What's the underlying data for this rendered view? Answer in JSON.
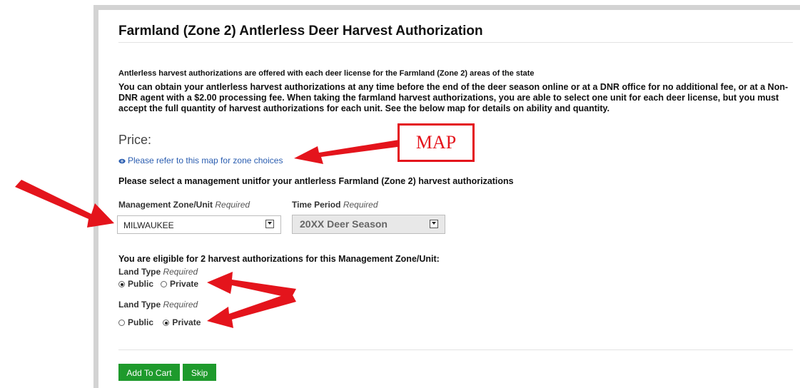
{
  "page": {
    "title": "Farmland (Zone 2) Antlerless Deer Harvest Authorization",
    "intro_small": "Antlerless harvest authorizations are offered with each deer license for the Farmland (Zone 2) areas of the state",
    "intro_para": "You can obtain your antlerless harvest authorizations at any time before the end of the deer season online or at a DNR office for no additional fee, or at a Non-DNR agent with a $2.00 processing fee.  When taking the farmland harvest authorizations, you are able to select one unit for each deer license, but you must accept the full quantity of harvest authorizations for each unit.  See the below map for details on ability and quantity.",
    "price_label": "Price:",
    "map_link": "Please refer to this map for zone choices",
    "select_heading": "Please select a management unitfor your antlerless Farmland (Zone 2) harvest authorizations"
  },
  "form": {
    "zone_label": "Management Zone/Unit",
    "zone_required": "Required",
    "zone_value": "MILWAUKEE",
    "period_label": "Time Period",
    "period_required": "Required",
    "period_value": "20XX Deer Season",
    "eligible_text": "You are eligible for 2 harvest authorizations for this Management Zone/Unit:",
    "land_types": [
      {
        "label": "Land Type",
        "required": "Required",
        "public": "Public",
        "private": "Private",
        "selected": "Public"
      },
      {
        "label": "Land Type",
        "required": "Required",
        "public": "Public",
        "private": "Private",
        "selected": "Private"
      }
    ]
  },
  "buttons": {
    "add_to_cart": "Add To Cart",
    "skip": "Skip"
  },
  "annotation": {
    "map_callout": "MAP",
    "color": "#e4141c"
  },
  "colors": {
    "button_green": "#1e9a2c",
    "link_blue": "#2a5db0"
  }
}
